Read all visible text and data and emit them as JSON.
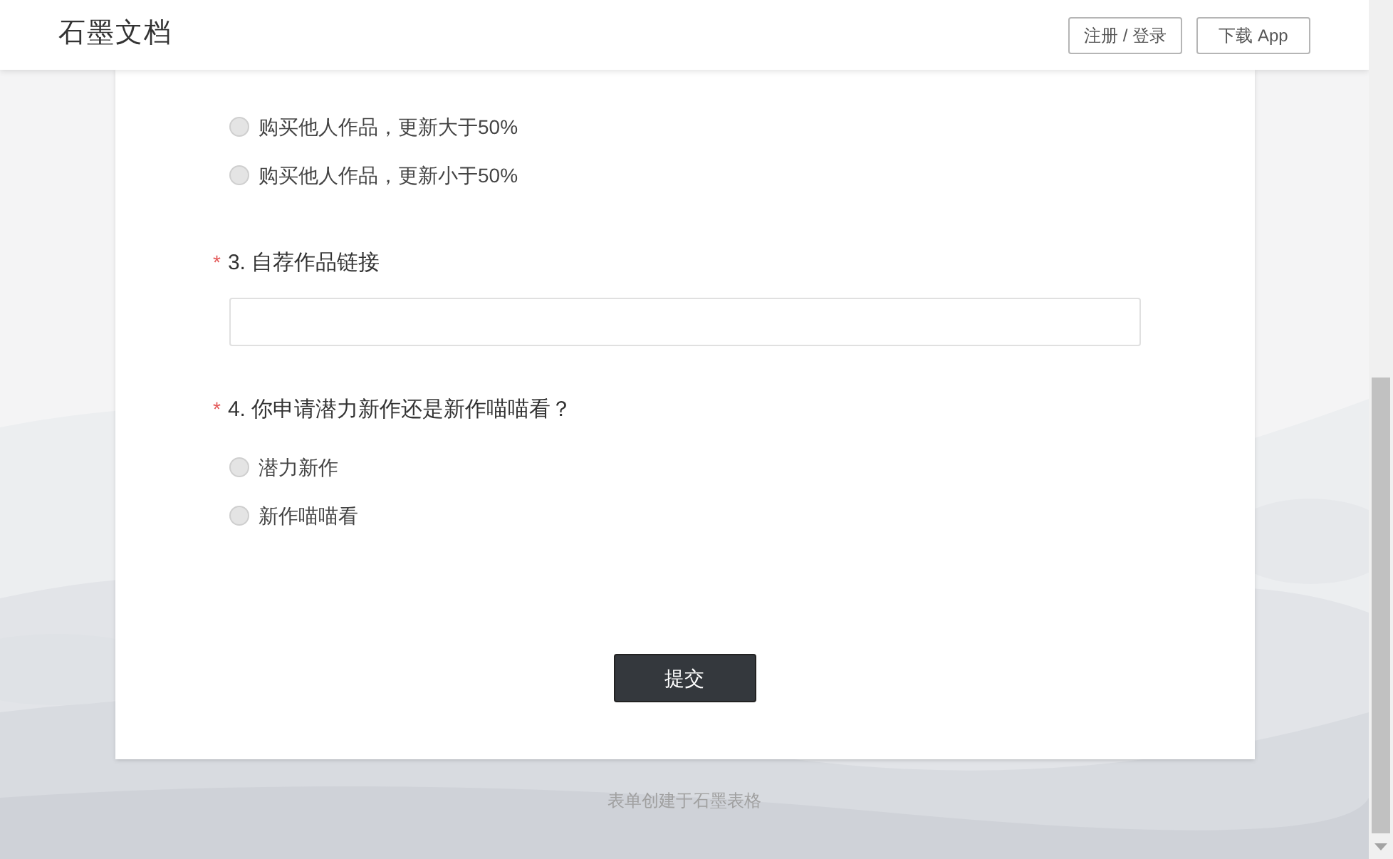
{
  "header": {
    "logo": "石墨文档",
    "buttons": [
      "注册 / 登录",
      "下载 App"
    ]
  },
  "questions": [
    {
      "kind": "choice",
      "options": [
        {
          "label": "购买他人作品，更新大于50%",
          "selected": false
        },
        {
          "label": "购买他人作品，更新小于50%",
          "selected": false
        }
      ]
    },
    {
      "kind": "text",
      "required_mark": "*",
      "title": "3. 自荐作品链接"
    },
    {
      "kind": "choice",
      "required_mark": "*",
      "title": "4. 你申请潜力新作还是新作喵喵看？",
      "options": [
        {
          "label": "潜力新作",
          "selected": false
        },
        {
          "label": "新作喵喵看",
          "selected": false
        }
      ]
    }
  ],
  "submit": "提交",
  "footer": "表单创建于石墨表格"
}
